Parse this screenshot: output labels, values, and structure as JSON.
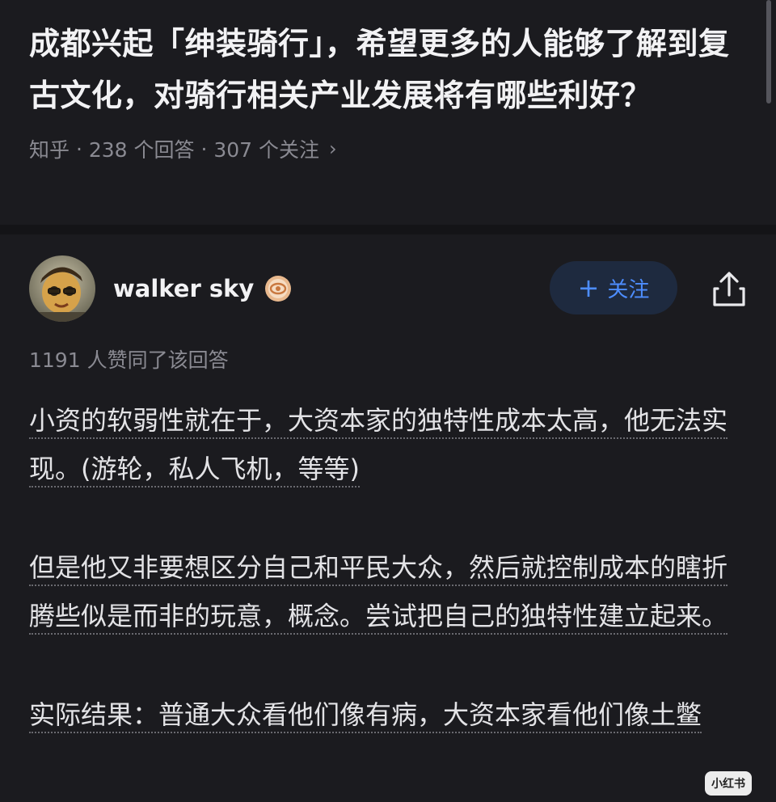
{
  "question": {
    "title": "成都兴起「绅装骑行」，希望更多的人能够了解到复古文化，对骑行相关产业发展将有哪些利好？",
    "source": "知乎",
    "answers_count": "238 个回答",
    "followers_count": "307 个关注",
    "separator": " · "
  },
  "author": {
    "name": "walker sky",
    "badge_icon": "verified-badge-icon",
    "avatar_icon": "user-avatar"
  },
  "actions": {
    "follow_label": "关注",
    "follow_plus": "+",
    "share_icon": "share-icon"
  },
  "answer": {
    "likes_text": "1191 人赞同了该回答",
    "paragraphs": [
      "小资的软弱性就在于，大资本家的独特性成本太高，他无法实现。(游轮，私人飞机，等等)",
      "但是他又非要想区分自己和平民大众，然后就控制成本的瞎折腾些似是而非的玩意，概念。尝试把自己的独特性建立起来。",
      "实际结果：普通大众看他们像有病，大资本家看他们像土鳖"
    ]
  },
  "watermark": {
    "text": "小红书"
  },
  "colors": {
    "background": "#1b1b1f",
    "accent": "#4d8dff",
    "follow_bg": "#1e2a3f",
    "muted_text": "#8a8a92"
  }
}
